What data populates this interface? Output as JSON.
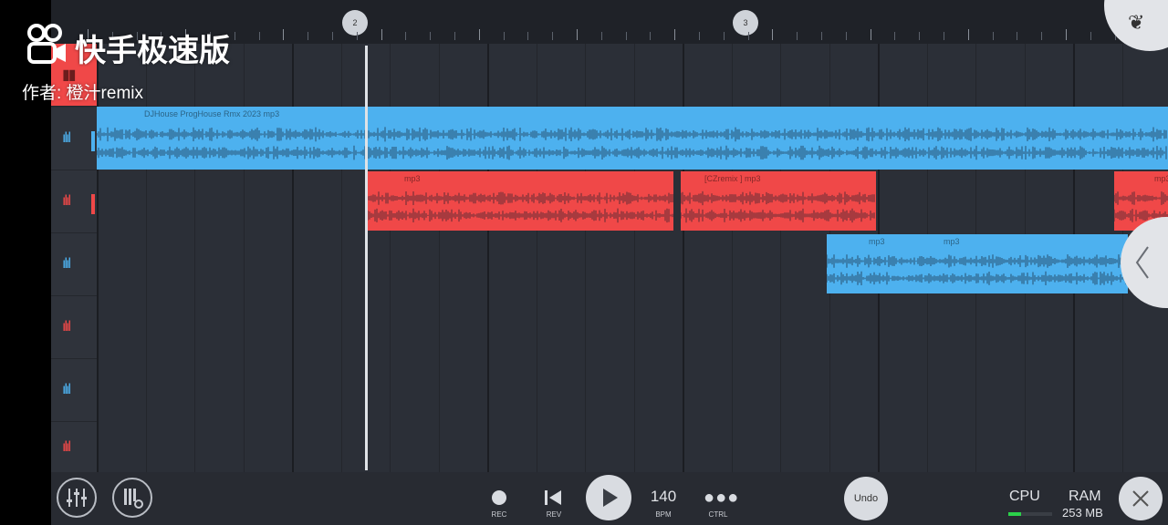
{
  "watermark": {
    "app_name": "快手极速版",
    "author": "作者: 橙汁remix"
  },
  "ruler": {
    "markers": [
      "2",
      "3"
    ]
  },
  "clips": {
    "track1_clip1": "DJHouse ProgHouse Rmx 2023      mp3",
    "track2_clip1": "mp3",
    "track2_clip2": "[CZremix  ] mp3",
    "track2_clip3": "mp3",
    "track3_clip1": "mp3",
    "track3_clip2": "mp3"
  },
  "transport": {
    "rec_label": "REC",
    "rev_label": "REV",
    "bpm_value": "140",
    "bpm_label": "BPM",
    "ctrl_label": "CTRL",
    "undo_label": "Undo",
    "cpu_label": "CPU",
    "ram_label": "RAM",
    "ram_value": "253 MB",
    "cpu_level": 0.3
  },
  "colors": {
    "audio_blue": "#4db1ef",
    "audio_red": "#f04848",
    "background": "#2b2f37"
  }
}
